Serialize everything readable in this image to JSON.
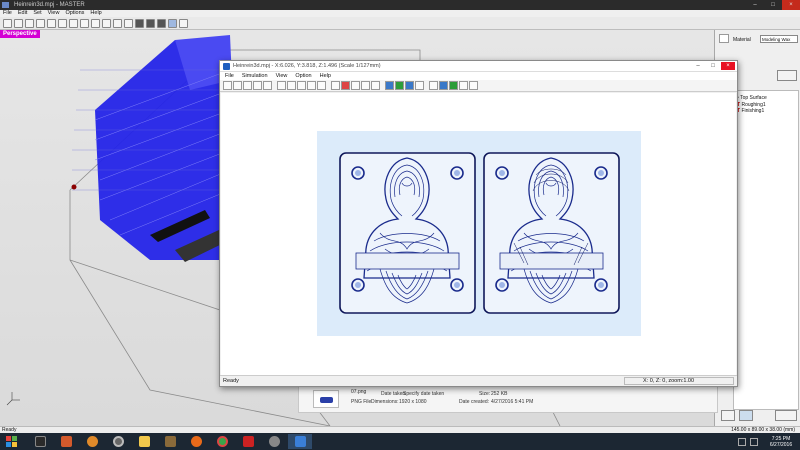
{
  "bg_app": {
    "title": "Heinrein3d.mpj - MASTER",
    "menu": [
      "File",
      "Edit",
      "Set",
      "View",
      "Options",
      "Help"
    ],
    "viewport_label": "Perspective",
    "status": "Ready",
    "dimensions": "145.00 x 89.00 x 38.00 (mm)"
  },
  "right_panel": {
    "material_label": "Material",
    "material_value": "Modeling Wax",
    "tree": [
      {
        "label": "Top Surface",
        "marker": ""
      },
      {
        "label": "Roughing1",
        "marker": "T"
      },
      {
        "label": "Finishing1",
        "marker": "T"
      }
    ]
  },
  "file_strip": {
    "filename": "07.png",
    "type": "PNG File",
    "date_taken_label": "Date taken:",
    "date_taken_value": "Specify date taken",
    "dimensions_label": "Dimensions:",
    "dimensions_value": "1920 x 1080",
    "size_label": "Size:",
    "size_value": "252 KB",
    "created_label": "Date created:",
    "created_value": "4/27/2016 5:41 PM"
  },
  "fg_window": {
    "title": "Heinrein3d.mpj - X:6.026, Y:3.818, Z:1.496 (Scale 1/127mm)",
    "menu": [
      "File",
      "Simulation",
      "View",
      "Option",
      "Help"
    ],
    "status": "Ready",
    "coords": "X: 0, Z: 0, zoom:1.00"
  },
  "taskbar": {
    "time": "7:25 PM",
    "date": "6/27/2016"
  },
  "colors": {
    "toolpath_blue": "#1a1ae6",
    "mold_bg": "#dcebfa",
    "contour": "#1a2b8c",
    "label_magenta": "#d400d4"
  }
}
